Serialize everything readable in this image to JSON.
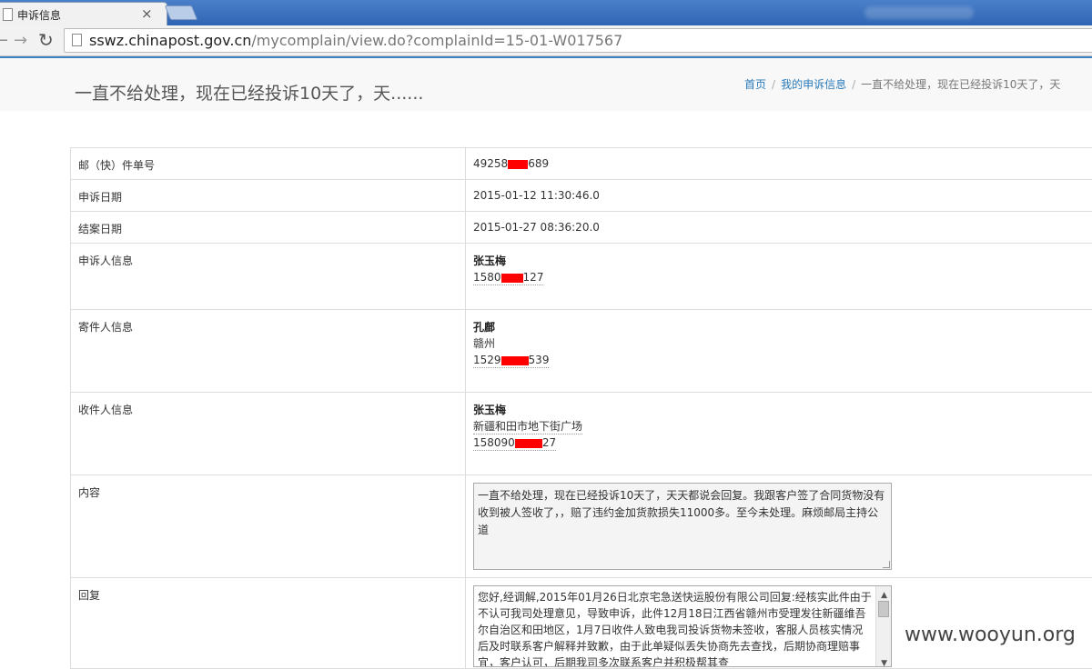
{
  "browser": {
    "tab_title": "申诉信息",
    "tab_close": "×",
    "url_host": "sswz.chinapost.gov.cn",
    "url_path": "/mycomplain/view.do?complainId=15-01-W017567",
    "icons": {
      "back": "arrow-left-icon",
      "forward": "arrow-right-icon",
      "reload": "reload-icon",
      "page": "page-icon"
    }
  },
  "header": {
    "title": "一直不给处理，现在已经投诉10天了，天......",
    "breadcrumb": [
      "首页",
      "我的申诉信息",
      "一直不给处理，现在已经投诉10天了，天"
    ]
  },
  "details": {
    "waybill_label": "邮（快）件单号",
    "waybill_prefix": "49258",
    "waybill_suffix": "689",
    "complain_date_label": "申诉日期",
    "complain_date": "2015-01-12 11:30:46.0",
    "close_date_label": "结案日期",
    "close_date": "2015-01-27 08:36:20.0",
    "complainant_label": "申诉人信息",
    "complainant_name": "张玉梅",
    "complainant_phone_prefix": "1580",
    "complainant_phone_suffix": "127",
    "sender_label": "寄件人信息",
    "sender_name": "孔鄜",
    "sender_city": "赣州",
    "sender_phone_prefix": "1529",
    "sender_phone_suffix": "539",
    "receiver_label": "收件人信息",
    "receiver_name": "张玉梅",
    "receiver_address": "新疆和田市地下街广场",
    "receiver_phone_prefix": "158090",
    "receiver_phone_suffix": "27",
    "content_label": "内容",
    "content_text": "一直不给处理，现在已经投诉10天了，天天都说会回复。我跟客户签了合同货物没有收到被人签收了，，赔了违约金加货款损失11000多。至今未处理。麻烦邮局主持公道",
    "reply_label": "回复",
    "reply_text": "您好,经调解,2015年01月26日北京宅急送快运股份有限公司回复:经核实此件由于不认可我司处理意见，导致申诉，此件12月18日江西省赣州市受理发往新疆维吾尔自治区和田地区，1月7日收件人致电我司投诉货物未签收，客服人员核实情况后及时联系客户解释并致歉，由于此单疑似丢失协商先去查找，后期协商理赔事宜，客户认可，后期我司多次联系客户并积极帮其查"
  },
  "watermark": "www.wooyun.org"
}
